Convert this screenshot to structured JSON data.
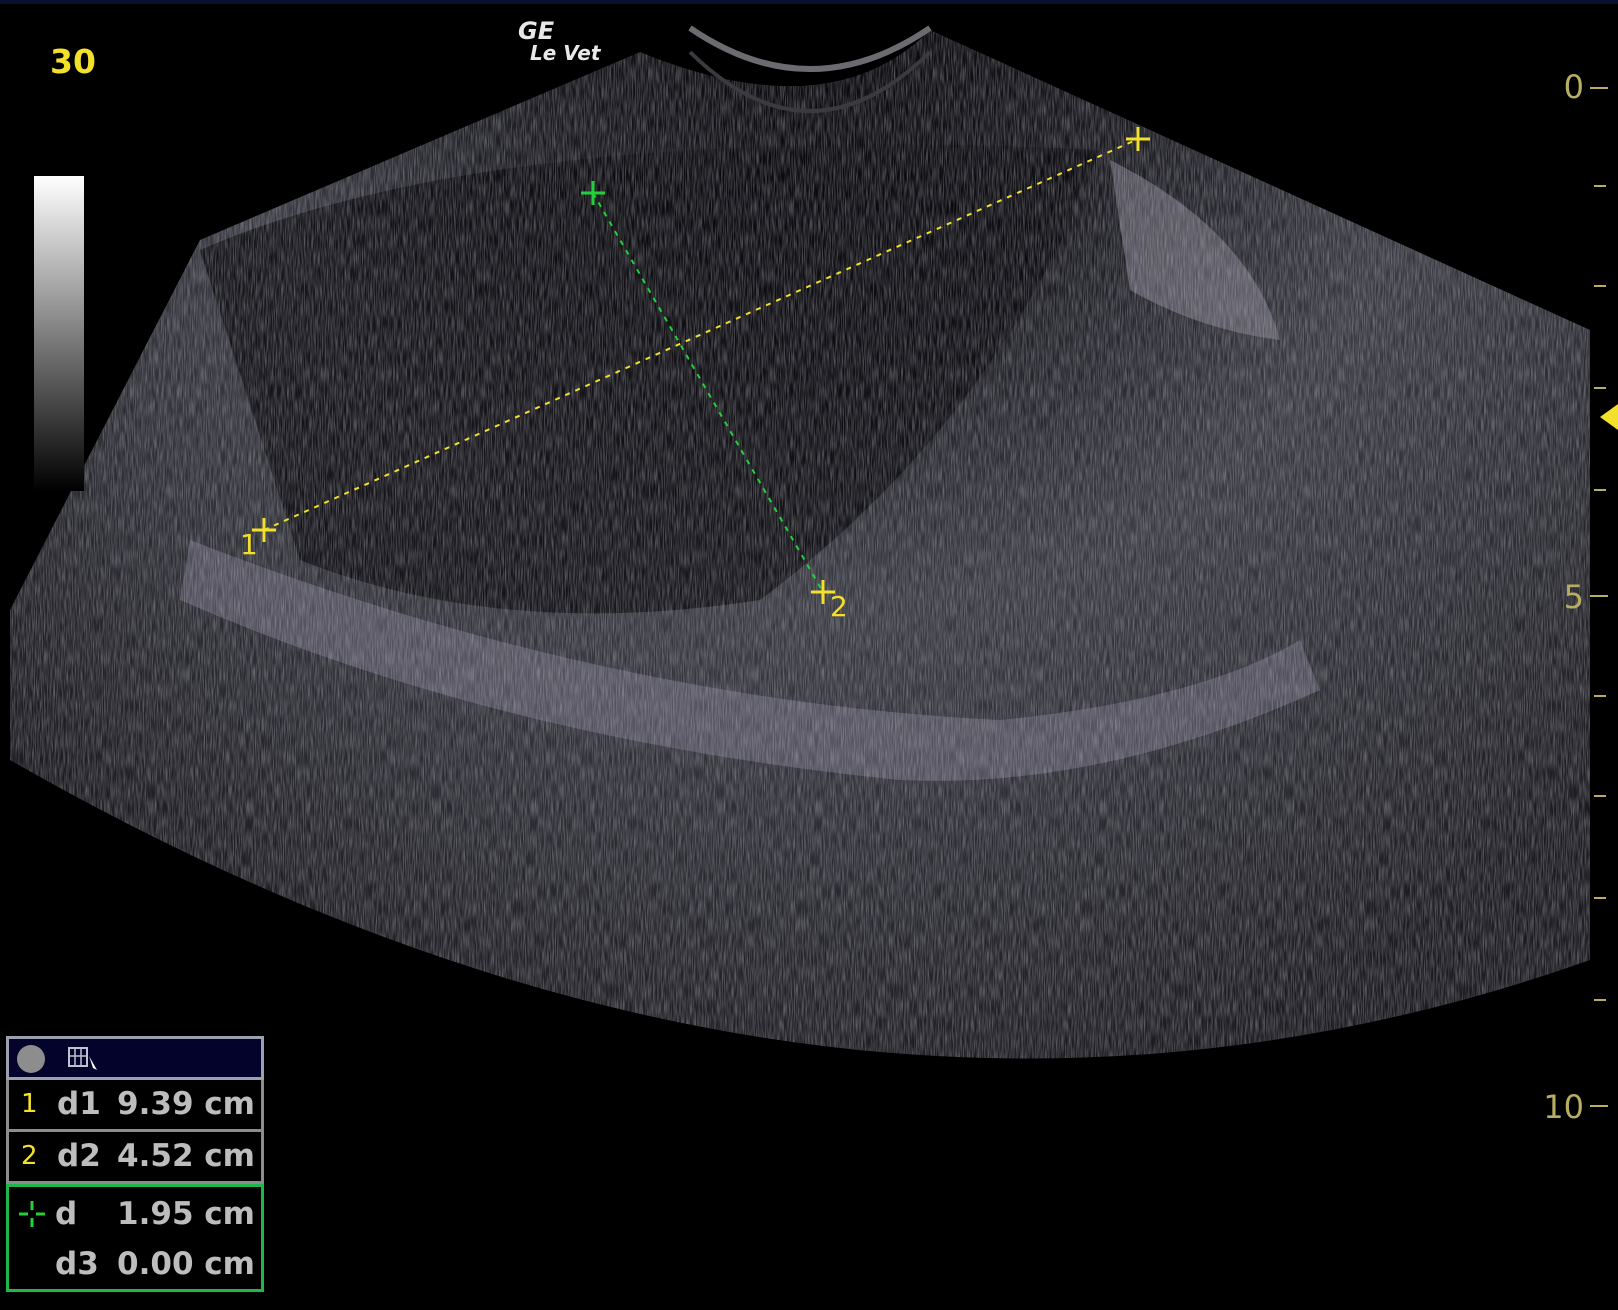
{
  "frame_number": "30",
  "brand": {
    "line1": "GE",
    "line2": "Le Vet"
  },
  "depth_scale": {
    "labels": [
      "0",
      "5",
      "10"
    ]
  },
  "calipers": {
    "d1": {
      "label_start": "1"
    },
    "d2": {
      "label_end": "2"
    }
  },
  "measurements": [
    {
      "index": "1",
      "name": "d1",
      "value": "9.39 cm"
    },
    {
      "index": "2",
      "name": "d2",
      "value": "4.52 cm"
    }
  ],
  "active_measurement": {
    "name": "d",
    "value": "1.95 cm",
    "sub_name": "d3",
    "sub_value": "0.00 cm"
  },
  "colors": {
    "yellow": "#f3e02a",
    "green": "#22d13a",
    "depth_text": "#b7ad63",
    "panel_border": "#8c8c8c",
    "active_border": "#20b64a"
  },
  "icons": [
    "record-dot-icon",
    "measure-tool-icon",
    "caliper-cross-icon",
    "focus-marker-icon"
  ]
}
